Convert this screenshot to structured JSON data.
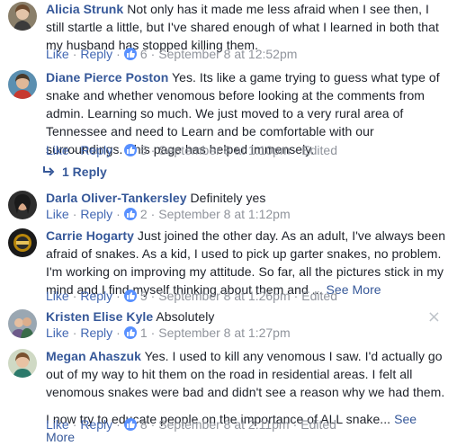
{
  "labels": {
    "like": "Like",
    "reply": "Reply",
    "separator": "·"
  },
  "comments": [
    {
      "name": "Alicia Strunk",
      "text": "Not only has it made me less afraid when I see then, I still startle a little, but I've shared enough of what I learned in both that my husband has stopped killing them.",
      "likes": "6",
      "time": "September 8 at 12:52pm"
    },
    {
      "name": "Diane Pierce Poston",
      "text": "Yes. Its like a game trying to guess what type of snake and whether venomous before looking at the comments from admin. Learning so much. We just moved to a very rural area of Tennessee and need to Learn and be comfortable with our surroundings. This page has helped immensely.",
      "likes": "5",
      "time": "September 8 at 1:10pm",
      "edited": "Edited",
      "replies_label": "1 Reply"
    },
    {
      "name": "Darla Oliver-Tankersley",
      "text": "Definitely yes",
      "likes": "2",
      "time": "September 8 at 1:12pm"
    },
    {
      "name": "Carrie Hogarty",
      "text": "Just joined the other day. As an adult, I've always been afraid of snakes. As a kid, I used to pick up garter snakes, no problem. I'm working on improving my attitude. So far, all the pictures stick in my mind and I find myself thinking about them and ...",
      "see_more": "See More",
      "likes": "5",
      "time": "September 8 at 1:26pm",
      "edited": "Edited"
    },
    {
      "name": "Kristen Elise Kyle",
      "text": "Absolutely",
      "likes": "1",
      "time": "September 8 at 1:27pm",
      "close_icon": "×"
    },
    {
      "name": "Megan Ahaszuk",
      "text": "Yes. I used to kill any venomous I saw. I'd actually go out of my way to hit them on the road in residential areas. I felt all venomous snakes were bad and didn't see a reason why we had them.",
      "text2": "I now try to educate people on the importance of ALL snake...",
      "see_more": "See More",
      "likes": "8",
      "time": "September 8 at 2:11pm",
      "edited": "Edited"
    }
  ],
  "colors": {
    "link": "#365899",
    "action": "#4267b2",
    "meta": "#90949c",
    "like_badge": "#5890ff",
    "text": "#1d2129"
  },
  "icons": {
    "like": "thumbs-up-icon",
    "reply_arrow": "reply-arrow-icon",
    "close": "close-icon"
  }
}
